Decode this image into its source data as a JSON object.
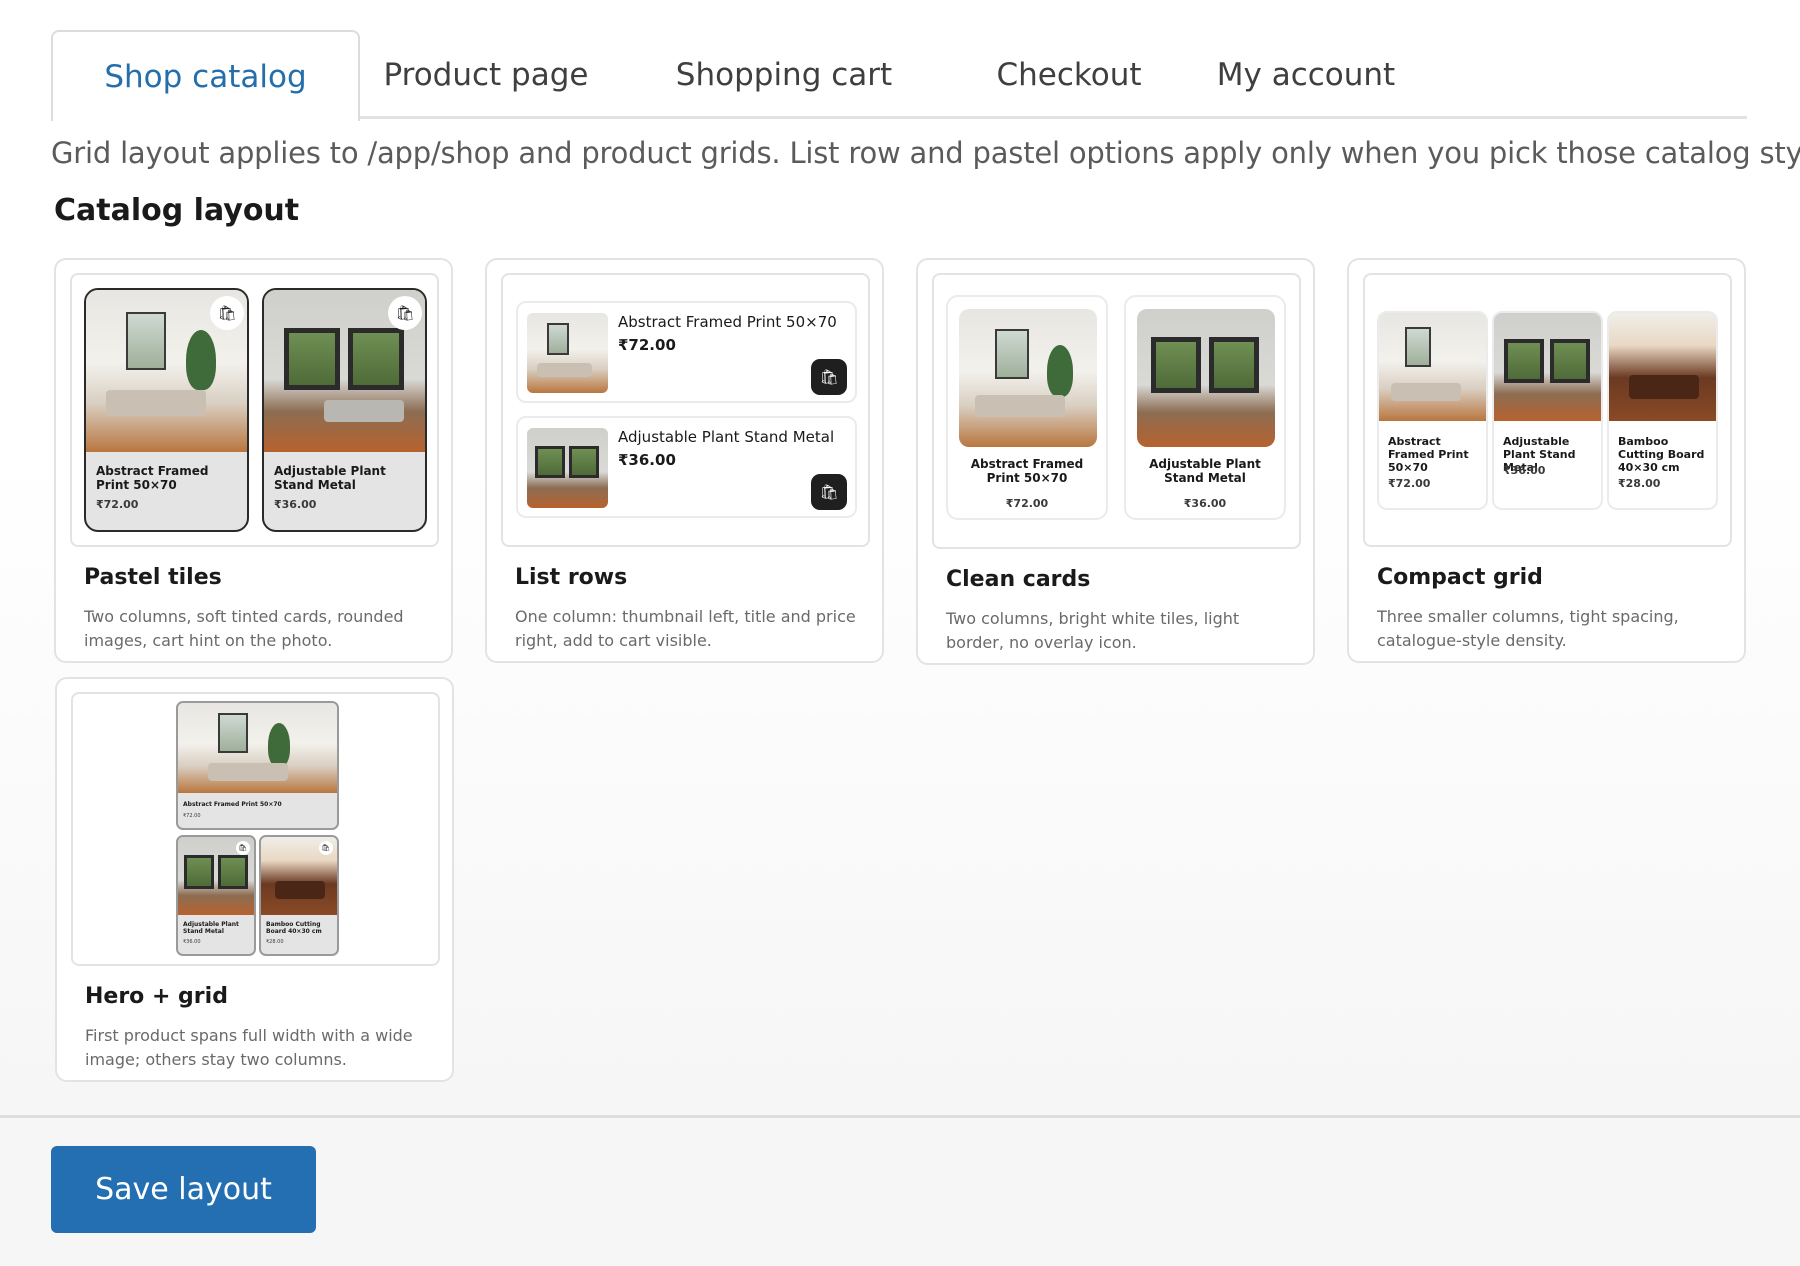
{
  "tabs": [
    {
      "label": "Shop catalog",
      "active": true
    },
    {
      "label": "Product page"
    },
    {
      "label": "Shopping cart"
    },
    {
      "label": "Checkout"
    },
    {
      "label": "My account"
    }
  ],
  "hint": "Grid layout applies to /app/shop and product grids. List row and pastel options apply only when you pick those catalog styles.",
  "section_title": "Catalog layout",
  "products": [
    {
      "name": "Abstract Framed Print 50×70",
      "price": "₹72.00"
    },
    {
      "name": "Adjustable Plant Stand Metal",
      "price": "₹36.00"
    },
    {
      "name": "Bamboo Cutting Board 40×30 cm",
      "price": "₹28.00"
    }
  ],
  "layouts": [
    {
      "title": "Pastel tiles",
      "desc": "Two columns, soft tinted cards, rounded images, cart hint on the photo."
    },
    {
      "title": "List rows",
      "desc": "One column: thumbnail left, title and price right, add to cart visible."
    },
    {
      "title": "Clean cards",
      "desc": "Two columns, bright white tiles, light border, no overlay icon."
    },
    {
      "title": "Compact grid",
      "desc": "Three smaller columns, tight spacing, catalogue-style density."
    },
    {
      "title": "Hero + grid",
      "desc": "First product spans full width with a wide image; others stay two columns."
    }
  ],
  "icons": {
    "cart": "shopping-bag-icon"
  },
  "colors": {
    "accent": "#236fb1",
    "active_tab": "#246fab"
  },
  "save_label": "Save layout"
}
